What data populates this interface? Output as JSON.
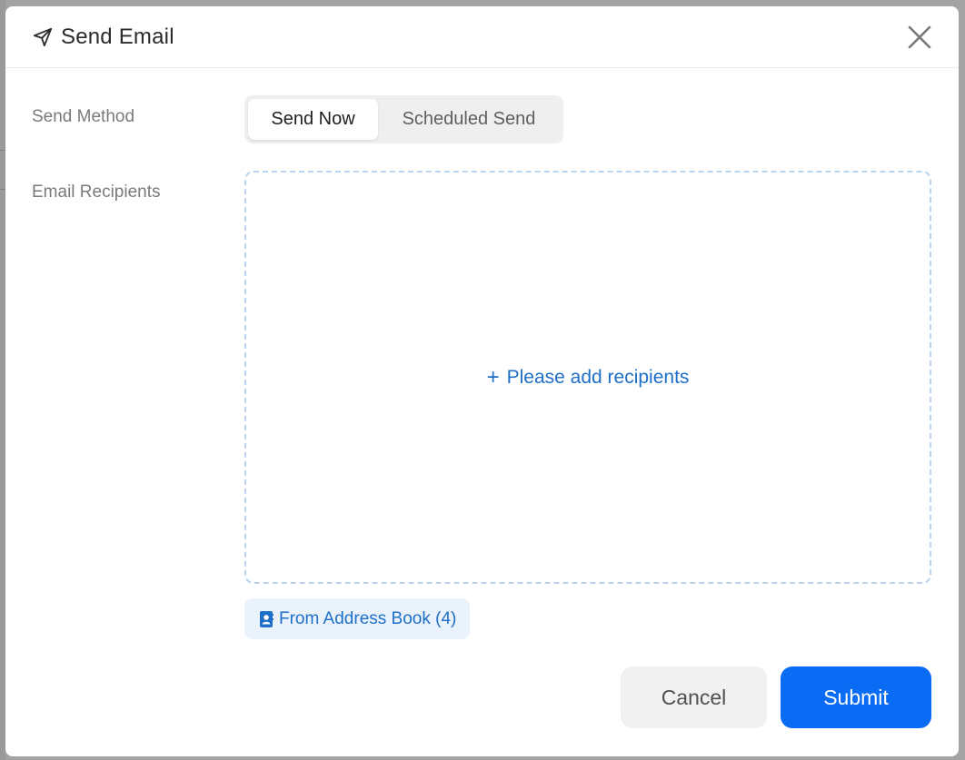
{
  "dialog": {
    "title": "Send Email",
    "title_icon": "paper-plane-icon",
    "close_icon": "close-icon"
  },
  "send_method": {
    "label": "Send Method",
    "options": [
      "Send Now",
      "Scheduled Send"
    ],
    "selected": "Send Now"
  },
  "recipients": {
    "label": "Email Recipients",
    "add_icon": "plus-icon",
    "add_text": "Please add recipients",
    "address_book_icon": "contact-book-icon",
    "address_book_label": "From Address Book (4)"
  },
  "actions": {
    "cancel_label": "Cancel",
    "submit_label": "Submit"
  },
  "colors": {
    "accent": "#0a6cf5",
    "link": "#1e6fc7",
    "dashed_border": "#b9d4ef"
  }
}
